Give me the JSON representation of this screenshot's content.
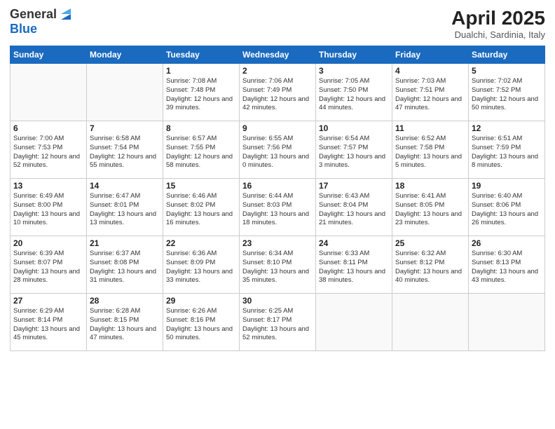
{
  "header": {
    "logo_general": "General",
    "logo_blue": "Blue",
    "main_title": "April 2025",
    "subtitle": "Dualchi, Sardinia, Italy"
  },
  "calendar": {
    "days_of_week": [
      "Sunday",
      "Monday",
      "Tuesday",
      "Wednesday",
      "Thursday",
      "Friday",
      "Saturday"
    ],
    "weeks": [
      [
        {
          "day": "",
          "info": ""
        },
        {
          "day": "",
          "info": ""
        },
        {
          "day": "1",
          "info": "Sunrise: 7:08 AM\nSunset: 7:48 PM\nDaylight: 12 hours and 39 minutes."
        },
        {
          "day": "2",
          "info": "Sunrise: 7:06 AM\nSunset: 7:49 PM\nDaylight: 12 hours and 42 minutes."
        },
        {
          "day": "3",
          "info": "Sunrise: 7:05 AM\nSunset: 7:50 PM\nDaylight: 12 hours and 44 minutes."
        },
        {
          "day": "4",
          "info": "Sunrise: 7:03 AM\nSunset: 7:51 PM\nDaylight: 12 hours and 47 minutes."
        },
        {
          "day": "5",
          "info": "Sunrise: 7:02 AM\nSunset: 7:52 PM\nDaylight: 12 hours and 50 minutes."
        }
      ],
      [
        {
          "day": "6",
          "info": "Sunrise: 7:00 AM\nSunset: 7:53 PM\nDaylight: 12 hours and 52 minutes."
        },
        {
          "day": "7",
          "info": "Sunrise: 6:58 AM\nSunset: 7:54 PM\nDaylight: 12 hours and 55 minutes."
        },
        {
          "day": "8",
          "info": "Sunrise: 6:57 AM\nSunset: 7:55 PM\nDaylight: 12 hours and 58 minutes."
        },
        {
          "day": "9",
          "info": "Sunrise: 6:55 AM\nSunset: 7:56 PM\nDaylight: 13 hours and 0 minutes."
        },
        {
          "day": "10",
          "info": "Sunrise: 6:54 AM\nSunset: 7:57 PM\nDaylight: 13 hours and 3 minutes."
        },
        {
          "day": "11",
          "info": "Sunrise: 6:52 AM\nSunset: 7:58 PM\nDaylight: 13 hours and 5 minutes."
        },
        {
          "day": "12",
          "info": "Sunrise: 6:51 AM\nSunset: 7:59 PM\nDaylight: 13 hours and 8 minutes."
        }
      ],
      [
        {
          "day": "13",
          "info": "Sunrise: 6:49 AM\nSunset: 8:00 PM\nDaylight: 13 hours and 10 minutes."
        },
        {
          "day": "14",
          "info": "Sunrise: 6:47 AM\nSunset: 8:01 PM\nDaylight: 13 hours and 13 minutes."
        },
        {
          "day": "15",
          "info": "Sunrise: 6:46 AM\nSunset: 8:02 PM\nDaylight: 13 hours and 16 minutes."
        },
        {
          "day": "16",
          "info": "Sunrise: 6:44 AM\nSunset: 8:03 PM\nDaylight: 13 hours and 18 minutes."
        },
        {
          "day": "17",
          "info": "Sunrise: 6:43 AM\nSunset: 8:04 PM\nDaylight: 13 hours and 21 minutes."
        },
        {
          "day": "18",
          "info": "Sunrise: 6:41 AM\nSunset: 8:05 PM\nDaylight: 13 hours and 23 minutes."
        },
        {
          "day": "19",
          "info": "Sunrise: 6:40 AM\nSunset: 8:06 PM\nDaylight: 13 hours and 26 minutes."
        }
      ],
      [
        {
          "day": "20",
          "info": "Sunrise: 6:39 AM\nSunset: 8:07 PM\nDaylight: 13 hours and 28 minutes."
        },
        {
          "day": "21",
          "info": "Sunrise: 6:37 AM\nSunset: 8:08 PM\nDaylight: 13 hours and 31 minutes."
        },
        {
          "day": "22",
          "info": "Sunrise: 6:36 AM\nSunset: 8:09 PM\nDaylight: 13 hours and 33 minutes."
        },
        {
          "day": "23",
          "info": "Sunrise: 6:34 AM\nSunset: 8:10 PM\nDaylight: 13 hours and 35 minutes."
        },
        {
          "day": "24",
          "info": "Sunrise: 6:33 AM\nSunset: 8:11 PM\nDaylight: 13 hours and 38 minutes."
        },
        {
          "day": "25",
          "info": "Sunrise: 6:32 AM\nSunset: 8:12 PM\nDaylight: 13 hours and 40 minutes."
        },
        {
          "day": "26",
          "info": "Sunrise: 6:30 AM\nSunset: 8:13 PM\nDaylight: 13 hours and 43 minutes."
        }
      ],
      [
        {
          "day": "27",
          "info": "Sunrise: 6:29 AM\nSunset: 8:14 PM\nDaylight: 13 hours and 45 minutes."
        },
        {
          "day": "28",
          "info": "Sunrise: 6:28 AM\nSunset: 8:15 PM\nDaylight: 13 hours and 47 minutes."
        },
        {
          "day": "29",
          "info": "Sunrise: 6:26 AM\nSunset: 8:16 PM\nDaylight: 13 hours and 50 minutes."
        },
        {
          "day": "30",
          "info": "Sunrise: 6:25 AM\nSunset: 8:17 PM\nDaylight: 13 hours and 52 minutes."
        },
        {
          "day": "",
          "info": ""
        },
        {
          "day": "",
          "info": ""
        },
        {
          "day": "",
          "info": ""
        }
      ]
    ]
  }
}
